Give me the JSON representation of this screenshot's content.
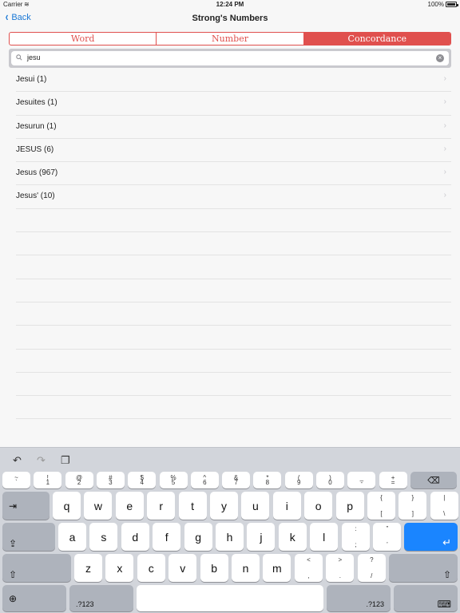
{
  "status": {
    "carrier": "Carrier",
    "time": "12:24 PM",
    "battery": "100%"
  },
  "nav": {
    "back_label": "Back",
    "title": "Strong's Numbers"
  },
  "tabs": [
    {
      "label": "Word",
      "active": false
    },
    {
      "label": "Number",
      "active": false
    },
    {
      "label": "Concordance",
      "active": true
    }
  ],
  "search": {
    "value": "jesu"
  },
  "results": [
    {
      "label": "Jesui (1)"
    },
    {
      "label": "Jesuites (1)"
    },
    {
      "label": "Jesurun (1)"
    },
    {
      "label": "JESUS (6)"
    },
    {
      "label": "Jesus (967)"
    },
    {
      "label": "Jesus' (10)"
    }
  ],
  "keyboard": {
    "number_row": [
      {
        "top": "~",
        "bot": "`"
      },
      {
        "top": "!",
        "bot": "1"
      },
      {
        "top": "@",
        "bot": "2"
      },
      {
        "top": "#",
        "bot": "3"
      },
      {
        "top": "$",
        "bot": "4"
      },
      {
        "top": "%",
        "bot": "5"
      },
      {
        "top": "^",
        "bot": "6"
      },
      {
        "top": "&",
        "bot": "7"
      },
      {
        "top": "*",
        "bot": "8"
      },
      {
        "top": "(",
        "bot": "9"
      },
      {
        "top": ")",
        "bot": "0"
      },
      {
        "top": "_",
        "bot": "-"
      },
      {
        "top": "+",
        "bot": "="
      }
    ],
    "row_q": [
      "q",
      "w",
      "e",
      "r",
      "t",
      "y",
      "u",
      "i",
      "o",
      "p"
    ],
    "row_q_extra": [
      {
        "top": "{",
        "bot": "["
      },
      {
        "top": "}",
        "bot": "]"
      },
      {
        "top": "|",
        "bot": "\\"
      }
    ],
    "row_a": [
      "a",
      "s",
      "d",
      "f",
      "g",
      "h",
      "j",
      "k",
      "l"
    ],
    "row_a_extra": [
      {
        "top": ":",
        "bot": ";"
      },
      {
        "top": "”",
        "bot": "’"
      }
    ],
    "row_z": [
      "z",
      "x",
      "c",
      "v",
      "b",
      "n",
      "m"
    ],
    "row_z_extra": [
      {
        "top": "<",
        "bot": ","
      },
      {
        "top": ">",
        "bot": "."
      },
      {
        "top": "?",
        "bot": "/"
      }
    ],
    "mode_label": ".?123",
    "accent_color": "#e0504e",
    "return_color": "#1a85ff"
  }
}
